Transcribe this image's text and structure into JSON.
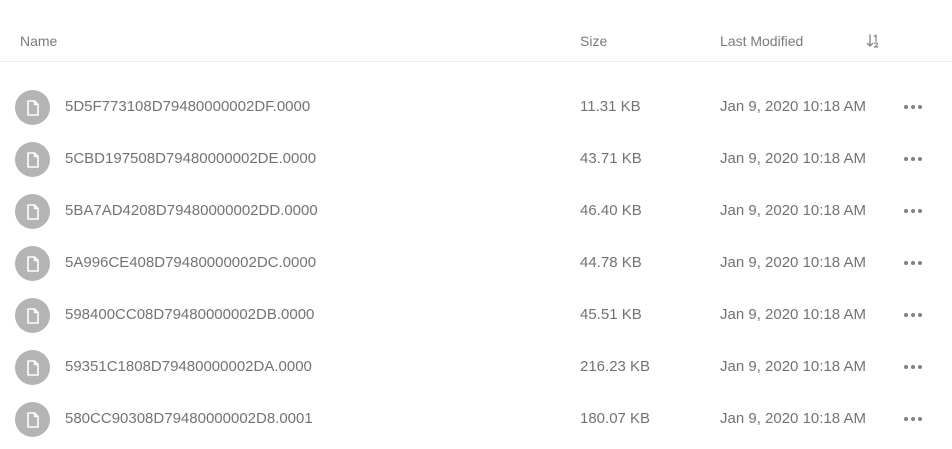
{
  "columns": {
    "name": "Name",
    "size": "Size",
    "last_modified": "Last Modified",
    "sort_icon": "sort-down-icon"
  },
  "files": [
    {
      "name": "5D5F773108D79480000002DF.0000",
      "size": "11.31 KB",
      "modified": "Jan 9, 2020 10:18 AM"
    },
    {
      "name": "5CBD197508D79480000002DE.0000",
      "size": "43.71 KB",
      "modified": "Jan 9, 2020 10:18 AM"
    },
    {
      "name": "5BA7AD4208D79480000002DD.0000",
      "size": "46.40 KB",
      "modified": "Jan 9, 2020 10:18 AM"
    },
    {
      "name": "5A996CE408D79480000002DC.0000",
      "size": "44.78 KB",
      "modified": "Jan 9, 2020 10:18 AM"
    },
    {
      "name": "598400CC08D79480000002DB.0000",
      "size": "45.51 KB",
      "modified": "Jan 9, 2020 10:18 AM"
    },
    {
      "name": "59351C1808D79480000002DA.0000",
      "size": "216.23 KB",
      "modified": "Jan 9, 2020 10:18 AM"
    },
    {
      "name": "580CC90308D79480000002D8.0001",
      "size": "180.07 KB",
      "modified": "Jan 9, 2020 10:18 AM"
    }
  ],
  "row_icons": {
    "file": "file-icon",
    "more": "more-options-icon"
  },
  "colors": {
    "icon_bg": "#b4b4b4",
    "text": "#737373",
    "divider": "#eeeeee"
  }
}
